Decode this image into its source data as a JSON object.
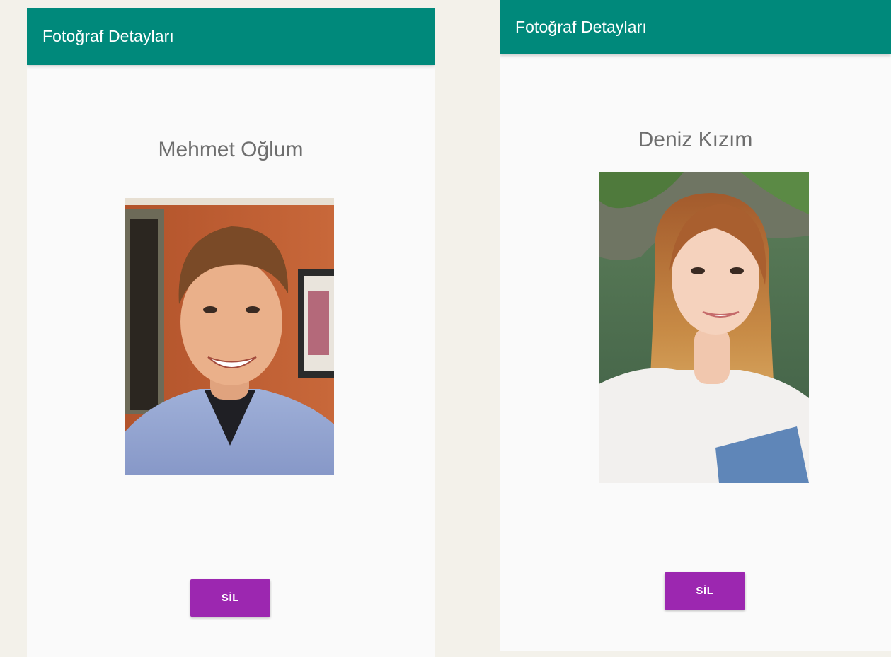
{
  "screens": [
    {
      "appbar": {
        "title": "Fotoğraf Detayları"
      },
      "photo": {
        "title": "Mehmet Oğlum"
      },
      "delete_button": {
        "label": "SİL"
      }
    },
    {
      "appbar": {
        "title": "Fotoğraf Detayları"
      },
      "photo": {
        "title": "Deniz Kızım"
      },
      "delete_button": {
        "label": "SİL"
      }
    }
  ],
  "colors": {
    "appbar": "#00897b",
    "button": "#9c27b0",
    "screen_background": "#fafafa",
    "page_background": "#f3f1ea"
  }
}
